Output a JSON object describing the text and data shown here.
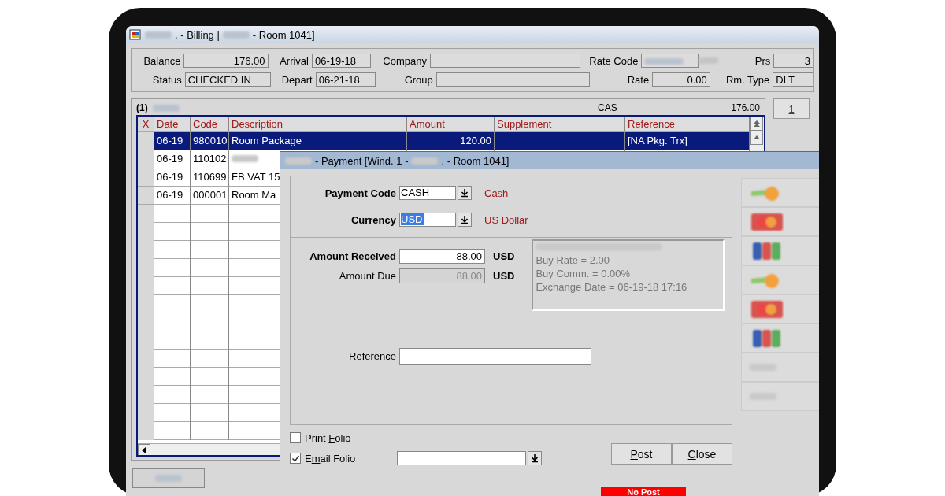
{
  "billing_window": {
    "title_parts": [
      ". - Billing |",
      "- Room 1041]"
    ],
    "header_rows": [
      [
        {
          "label": "Balance",
          "value": "176.00"
        },
        {
          "label": "Arrival",
          "value": "06-19-18"
        },
        {
          "label": "Company"
        },
        {
          "label": "Rate Code",
          "redacted": true
        },
        {
          "label": "Prs",
          "value": "3"
        }
      ],
      [
        {
          "label": "Status",
          "value": "CHECKED IN"
        },
        {
          "label": "Depart",
          "value": "06-21-18"
        },
        {
          "label": "Group"
        },
        {
          "label": "Rate",
          "value": "0.00"
        },
        {
          "label": "Rm. Type",
          "value": "DLT"
        }
      ]
    ],
    "folio": {
      "number": "(1)",
      "payment_type": "CAS",
      "total": "176.00"
    },
    "columns": [
      "X",
      "Date",
      "Code",
      "Description",
      "Amount",
      "Supplement",
      "Reference"
    ],
    "rows": [
      {
        "date": "06-19",
        "code": "980010",
        "description": "Room Package",
        "amount": "120.00",
        "reference": "[NA Pkg. Trx]",
        "selected": true
      },
      {
        "date": "06-19",
        "code": "110102",
        "description_redacted": true,
        "selected": false
      },
      {
        "date": "06-19",
        "code": "110699",
        "description": "FB VAT 15",
        "selected": false
      },
      {
        "date": "06-19",
        "code": "000001",
        "description": "Room Ma",
        "selected": false
      }
    ],
    "window_button": {
      "hotkey": "1"
    },
    "status_badge": "No Post"
  },
  "payment_window": {
    "title_parts": [
      "- Payment  [Wind. 1 -",
      ", - Room 1041]"
    ],
    "payment_code": {
      "label": "Payment Code",
      "value": "CASH",
      "description": "Cash"
    },
    "currency": {
      "label": "Currency",
      "value": "USD",
      "highlighted": true,
      "description": "US Dollar"
    },
    "amount_received": {
      "label": "Amount Received",
      "value": "88.00",
      "unit": "USD",
      "disabled": false
    },
    "amount_due": {
      "label": "Amount Due",
      "value": "88.00",
      "unit": "USD",
      "disabled": true
    },
    "exchange_info": [
      "Buy Rate = 2.00",
      "Buy Comm. = 0.00%",
      "Exchange Date = 06-19-18 17:16"
    ],
    "reference": {
      "label": "Reference"
    },
    "checkboxes": [
      {
        "before": "Print ",
        "hotkey": "F",
        "after": "olio",
        "checked": false
      },
      {
        "before": "E",
        "hotkey": "m",
        "after": "ail Folio",
        "checked": true
      }
    ],
    "buttons": [
      {
        "hotkey": "P",
        "rest": "ost"
      },
      {
        "hotkey": "C",
        "rest": "lose"
      }
    ],
    "methods": [
      {
        "kind": "coins"
      },
      {
        "kind": "card"
      },
      {
        "kind": "jcb"
      },
      {
        "kind": "coins"
      },
      {
        "kind": "card"
      },
      {
        "kind": "jcb"
      },
      {
        "kind": "text"
      },
      {
        "kind": "text"
      }
    ]
  }
}
